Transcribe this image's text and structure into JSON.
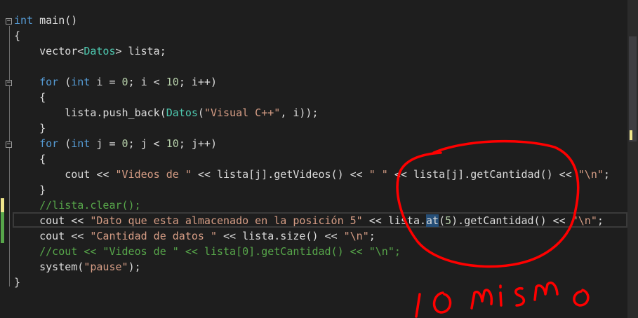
{
  "code": {
    "lines": [
      {
        "parts": [
          {
            "t": "int",
            "c": "kw"
          },
          {
            "t": " main()",
            "c": ""
          }
        ]
      },
      {
        "parts": [
          {
            "t": "{",
            "c": ""
          }
        ]
      },
      {
        "parts": [
          {
            "t": "    vector<",
            "c": ""
          },
          {
            "t": "Datos",
            "c": "ty"
          },
          {
            "t": "> lista;",
            "c": ""
          }
        ]
      },
      {
        "parts": [
          {
            "t": "",
            "c": ""
          }
        ]
      },
      {
        "parts": [
          {
            "t": "    ",
            "c": ""
          },
          {
            "t": "for",
            "c": "kw"
          },
          {
            "t": " (",
            "c": ""
          },
          {
            "t": "int",
            "c": "kw"
          },
          {
            "t": " i = ",
            "c": ""
          },
          {
            "t": "0",
            "c": "num"
          },
          {
            "t": "; i < ",
            "c": ""
          },
          {
            "t": "10",
            "c": "num"
          },
          {
            "t": "; i++)",
            "c": ""
          }
        ]
      },
      {
        "parts": [
          {
            "t": "    {",
            "c": ""
          }
        ]
      },
      {
        "parts": [
          {
            "t": "        lista.push_back(",
            "c": ""
          },
          {
            "t": "Datos",
            "c": "ty"
          },
          {
            "t": "(",
            "c": ""
          },
          {
            "t": "\"Visual C++\"",
            "c": "str"
          },
          {
            "t": ", i));",
            "c": ""
          }
        ]
      },
      {
        "parts": [
          {
            "t": "    }",
            "c": ""
          }
        ]
      },
      {
        "parts": [
          {
            "t": "    ",
            "c": ""
          },
          {
            "t": "for",
            "c": "kw"
          },
          {
            "t": " (",
            "c": ""
          },
          {
            "t": "int",
            "c": "kw"
          },
          {
            "t": " j = ",
            "c": ""
          },
          {
            "t": "0",
            "c": "num"
          },
          {
            "t": "; j < ",
            "c": ""
          },
          {
            "t": "10",
            "c": "num"
          },
          {
            "t": "; j++)",
            "c": ""
          }
        ]
      },
      {
        "parts": [
          {
            "t": "    {",
            "c": ""
          }
        ]
      },
      {
        "parts": [
          {
            "t": "        cout << ",
            "c": ""
          },
          {
            "t": "\"Videos de \"",
            "c": "str"
          },
          {
            "t": " << lista[j].getVideos() << ",
            "c": ""
          },
          {
            "t": "\" \"",
            "c": "str"
          },
          {
            "t": " << lista[j].getCantidad() << ",
            "c": ""
          },
          {
            "t": "\"\\n\"",
            "c": "str"
          },
          {
            "t": ";",
            "c": ""
          }
        ]
      },
      {
        "parts": [
          {
            "t": "    }",
            "c": ""
          }
        ]
      },
      {
        "parts": [
          {
            "t": "    //lista.clear();",
            "c": "cm"
          }
        ]
      },
      {
        "parts": [
          {
            "t": "    cout << ",
            "c": ""
          },
          {
            "t": "\"Dato que esta almacenado en la posición 5\"",
            "c": "str"
          },
          {
            "t": " << lista.",
            "c": ""
          },
          {
            "t": "at",
            "c": "hl"
          },
          {
            "t": "(",
            "c": ""
          },
          {
            "t": "5",
            "c": "num"
          },
          {
            "t": ").getCantidad() << ",
            "c": ""
          },
          {
            "t": "\"\\n\"",
            "c": "str"
          },
          {
            "t": ";",
            "c": ""
          }
        ]
      },
      {
        "parts": [
          {
            "t": "    cout << ",
            "c": ""
          },
          {
            "t": "\"Cantidad de datos \"",
            "c": "str"
          },
          {
            "t": " << lista.size() << ",
            "c": ""
          },
          {
            "t": "\"\\n\"",
            "c": "str"
          },
          {
            "t": ";",
            "c": ""
          }
        ]
      },
      {
        "parts": [
          {
            "t": "    //cout << \"Videos de \" << lista[0].getCantidad() << \"\\n\";",
            "c": "cm"
          }
        ]
      },
      {
        "parts": [
          {
            "t": "    system(",
            "c": ""
          },
          {
            "t": "\"pause\"",
            "c": "str"
          },
          {
            "t": ");",
            "c": ""
          }
        ]
      },
      {
        "parts": [
          {
            "t": "}",
            "c": ""
          }
        ]
      }
    ]
  },
  "fold_icons": [
    "collapse-icon",
    "collapse-icon",
    "collapse-icon"
  ],
  "annotation": {
    "handwritten_text": "lo mismo",
    "color": "#ff0000"
  },
  "colors": {
    "background": "#1e1e1e",
    "keyword": "#569cd6",
    "type": "#4ec9b0",
    "number": "#b5cea8",
    "string": "#d69d85",
    "comment": "#57a64a",
    "text": "#dcdcdc",
    "selection": "#264f78",
    "change_bar": "#f0e68c"
  }
}
